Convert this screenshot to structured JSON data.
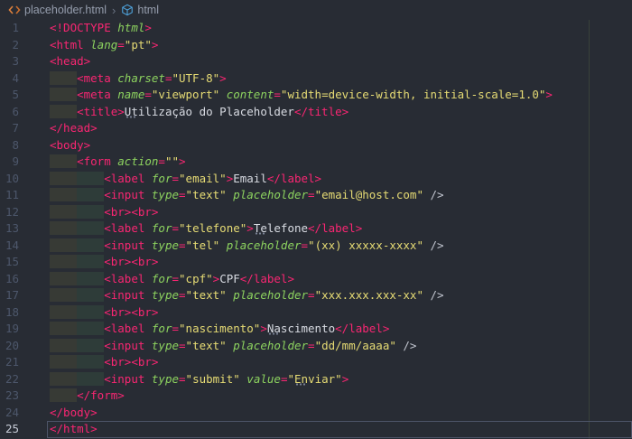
{
  "breadcrumb": {
    "file": "placeholder.html",
    "separator": "›",
    "symbol": "html"
  },
  "colors": {
    "background": "#282c34",
    "tag": "#f92672",
    "attribute": "#8dd35f",
    "string": "#e6db74",
    "text": "#d8dbe2",
    "line_number": "#4d576b",
    "active_line_number": "#c6cbd6",
    "breadcrumb_text": "#969eae",
    "file_icon": "#e0823d",
    "symbol_icon": "#4fa6e0"
  },
  "editor": {
    "active_line": 25,
    "lines": [
      {
        "n": 1,
        "tokens": [
          {
            "c": "tag",
            "t": "<!DOCTYPE "
          },
          {
            "c": "attr",
            "t": "html"
          },
          {
            "c": "tag",
            "t": ">"
          }
        ]
      },
      {
        "n": 2,
        "tokens": [
          {
            "c": "tag",
            "t": "<html "
          },
          {
            "c": "attr",
            "t": "lang"
          },
          {
            "c": "tag",
            "t": "="
          },
          {
            "c": "str",
            "t": "\"pt\""
          },
          {
            "c": "tag",
            "t": ">"
          }
        ]
      },
      {
        "n": 3,
        "tokens": [
          {
            "c": "tag",
            "t": "<head>"
          }
        ]
      },
      {
        "n": 4,
        "tokens": [
          {
            "c": "ind0",
            "t": "    "
          },
          {
            "c": "tag",
            "t": "<meta "
          },
          {
            "c": "attr",
            "t": "charset"
          },
          {
            "c": "tag",
            "t": "="
          },
          {
            "c": "str",
            "t": "\"UTF-8\""
          },
          {
            "c": "tag",
            "t": ">"
          }
        ]
      },
      {
        "n": 5,
        "tokens": [
          {
            "c": "ind0",
            "t": "    "
          },
          {
            "c": "tag",
            "t": "<meta "
          },
          {
            "c": "attr",
            "t": "name"
          },
          {
            "c": "tag",
            "t": "="
          },
          {
            "c": "str",
            "t": "\"viewport\""
          },
          {
            "c": "txt",
            "t": " "
          },
          {
            "c": "attr",
            "t": "content"
          },
          {
            "c": "tag",
            "t": "="
          },
          {
            "c": "str",
            "t": "\"width=device-width, initial-scale=1.0\""
          },
          {
            "c": "tag",
            "t": ">"
          }
        ]
      },
      {
        "n": 6,
        "tokens": [
          {
            "c": "ind0",
            "t": "    "
          },
          {
            "c": "tag",
            "t": "<title>"
          },
          {
            "c": "txt spell",
            "t": "Ut"
          },
          {
            "c": "txt",
            "t": "ilização do Placeholder"
          },
          {
            "c": "tag",
            "t": "</title>"
          }
        ]
      },
      {
        "n": 7,
        "tokens": [
          {
            "c": "tag",
            "t": "</head>"
          }
        ]
      },
      {
        "n": 8,
        "tokens": [
          {
            "c": "tag",
            "t": "<body>"
          }
        ]
      },
      {
        "n": 9,
        "tokens": [
          {
            "c": "ind0",
            "t": "    "
          },
          {
            "c": "tag",
            "t": "<form "
          },
          {
            "c": "attr",
            "t": "action"
          },
          {
            "c": "tag",
            "t": "="
          },
          {
            "c": "str",
            "t": "\"\""
          },
          {
            "c": "tag",
            "t": ">"
          }
        ]
      },
      {
        "n": 10,
        "tokens": [
          {
            "c": "ind0",
            "t": "    "
          },
          {
            "c": "ind1",
            "t": "    "
          },
          {
            "c": "tag",
            "t": "<label "
          },
          {
            "c": "attr",
            "t": "for"
          },
          {
            "c": "tag",
            "t": "="
          },
          {
            "c": "str",
            "t": "\"email\""
          },
          {
            "c": "tag",
            "t": ">"
          },
          {
            "c": "txt",
            "t": "Email"
          },
          {
            "c": "tag",
            "t": "</label>"
          }
        ]
      },
      {
        "n": 11,
        "tokens": [
          {
            "c": "ind0",
            "t": "    "
          },
          {
            "c": "ind1",
            "t": "    "
          },
          {
            "c": "tag",
            "t": "<input "
          },
          {
            "c": "attr",
            "t": "type"
          },
          {
            "c": "tag",
            "t": "="
          },
          {
            "c": "str",
            "t": "\"text\""
          },
          {
            "c": "txt",
            "t": " "
          },
          {
            "c": "attr",
            "t": "placeholder"
          },
          {
            "c": "tag",
            "t": "="
          },
          {
            "c": "str",
            "t": "\"email@host.com\""
          },
          {
            "c": "pun",
            "t": " />"
          }
        ]
      },
      {
        "n": 12,
        "tokens": [
          {
            "c": "ind0",
            "t": "    "
          },
          {
            "c": "ind1",
            "t": "    "
          },
          {
            "c": "tag",
            "t": "<br><br>"
          }
        ]
      },
      {
        "n": 13,
        "tokens": [
          {
            "c": "ind0",
            "t": "    "
          },
          {
            "c": "ind1",
            "t": "    "
          },
          {
            "c": "tag",
            "t": "<label "
          },
          {
            "c": "attr",
            "t": "for"
          },
          {
            "c": "tag",
            "t": "="
          },
          {
            "c": "str",
            "t": "\"telefone\""
          },
          {
            "c": "tag",
            "t": ">"
          },
          {
            "c": "txt spell",
            "t": "Te"
          },
          {
            "c": "txt",
            "t": "lefone"
          },
          {
            "c": "tag",
            "t": "</label>"
          }
        ]
      },
      {
        "n": 14,
        "tokens": [
          {
            "c": "ind0",
            "t": "    "
          },
          {
            "c": "ind1",
            "t": "    "
          },
          {
            "c": "tag",
            "t": "<input "
          },
          {
            "c": "attr",
            "t": "type"
          },
          {
            "c": "tag",
            "t": "="
          },
          {
            "c": "str",
            "t": "\"tel\""
          },
          {
            "c": "txt",
            "t": " "
          },
          {
            "c": "attr",
            "t": "placeholder"
          },
          {
            "c": "tag",
            "t": "="
          },
          {
            "c": "str",
            "t": "\"(xx) xxxxx-xxxx\""
          },
          {
            "c": "pun",
            "t": " />"
          }
        ]
      },
      {
        "n": 15,
        "tokens": [
          {
            "c": "ind0",
            "t": "    "
          },
          {
            "c": "ind1",
            "t": "    "
          },
          {
            "c": "tag",
            "t": "<br><br>"
          }
        ]
      },
      {
        "n": 16,
        "tokens": [
          {
            "c": "ind0",
            "t": "    "
          },
          {
            "c": "ind1",
            "t": "    "
          },
          {
            "c": "tag",
            "t": "<label "
          },
          {
            "c": "attr",
            "t": "for"
          },
          {
            "c": "tag",
            "t": "="
          },
          {
            "c": "str",
            "t": "\"cpf\""
          },
          {
            "c": "tag",
            "t": ">"
          },
          {
            "c": "txt",
            "t": "CPF"
          },
          {
            "c": "tag",
            "t": "</label>"
          }
        ]
      },
      {
        "n": 17,
        "tokens": [
          {
            "c": "ind0",
            "t": "    "
          },
          {
            "c": "ind1",
            "t": "    "
          },
          {
            "c": "tag",
            "t": "<input "
          },
          {
            "c": "attr",
            "t": "type"
          },
          {
            "c": "tag",
            "t": "="
          },
          {
            "c": "str",
            "t": "\"text\""
          },
          {
            "c": "txt",
            "t": " "
          },
          {
            "c": "attr",
            "t": "placeholder"
          },
          {
            "c": "tag",
            "t": "="
          },
          {
            "c": "str",
            "t": "\"xxx.xxx.xxx-xx\""
          },
          {
            "c": "pun",
            "t": " />"
          }
        ]
      },
      {
        "n": 18,
        "tokens": [
          {
            "c": "ind0",
            "t": "    "
          },
          {
            "c": "ind1",
            "t": "    "
          },
          {
            "c": "tag",
            "t": "<br><br>"
          }
        ]
      },
      {
        "n": 19,
        "tokens": [
          {
            "c": "ind0",
            "t": "    "
          },
          {
            "c": "ind1",
            "t": "    "
          },
          {
            "c": "tag",
            "t": "<label "
          },
          {
            "c": "attr",
            "t": "for"
          },
          {
            "c": "tag",
            "t": "="
          },
          {
            "c": "str",
            "t": "\"nascimento\""
          },
          {
            "c": "tag",
            "t": ">"
          },
          {
            "c": "txt spell",
            "t": "Na"
          },
          {
            "c": "txt",
            "t": "scimento"
          },
          {
            "c": "tag",
            "t": "</label>"
          }
        ]
      },
      {
        "n": 20,
        "tokens": [
          {
            "c": "ind0",
            "t": "    "
          },
          {
            "c": "ind1",
            "t": "    "
          },
          {
            "c": "tag",
            "t": "<input "
          },
          {
            "c": "attr",
            "t": "type"
          },
          {
            "c": "tag",
            "t": "="
          },
          {
            "c": "str",
            "t": "\"text\""
          },
          {
            "c": "txt",
            "t": " "
          },
          {
            "c": "attr",
            "t": "placeholder"
          },
          {
            "c": "tag",
            "t": "="
          },
          {
            "c": "str",
            "t": "\"dd/mm/aaaa\""
          },
          {
            "c": "pun",
            "t": " />"
          }
        ]
      },
      {
        "n": 21,
        "tokens": [
          {
            "c": "ind0",
            "t": "    "
          },
          {
            "c": "ind1",
            "t": "    "
          },
          {
            "c": "tag",
            "t": "<br><br>"
          }
        ]
      },
      {
        "n": 22,
        "tokens": [
          {
            "c": "ind0",
            "t": "    "
          },
          {
            "c": "ind1",
            "t": "    "
          },
          {
            "c": "tag",
            "t": "<input "
          },
          {
            "c": "attr",
            "t": "type"
          },
          {
            "c": "tag",
            "t": "="
          },
          {
            "c": "str",
            "t": "\"submit\""
          },
          {
            "c": "txt",
            "t": " "
          },
          {
            "c": "attr",
            "t": "value"
          },
          {
            "c": "tag",
            "t": "="
          },
          {
            "c": "str",
            "t": "\""
          },
          {
            "c": "str spell",
            "t": "En"
          },
          {
            "c": "str",
            "t": "viar\""
          },
          {
            "c": "tag",
            "t": ">"
          }
        ]
      },
      {
        "n": 23,
        "tokens": [
          {
            "c": "ind0",
            "t": "    "
          },
          {
            "c": "tag",
            "t": "</form>"
          }
        ]
      },
      {
        "n": 24,
        "tokens": [
          {
            "c": "tag",
            "t": "</body>"
          }
        ]
      },
      {
        "n": 25,
        "tokens": [
          {
            "c": "tag",
            "t": "</html>"
          }
        ]
      }
    ]
  }
}
